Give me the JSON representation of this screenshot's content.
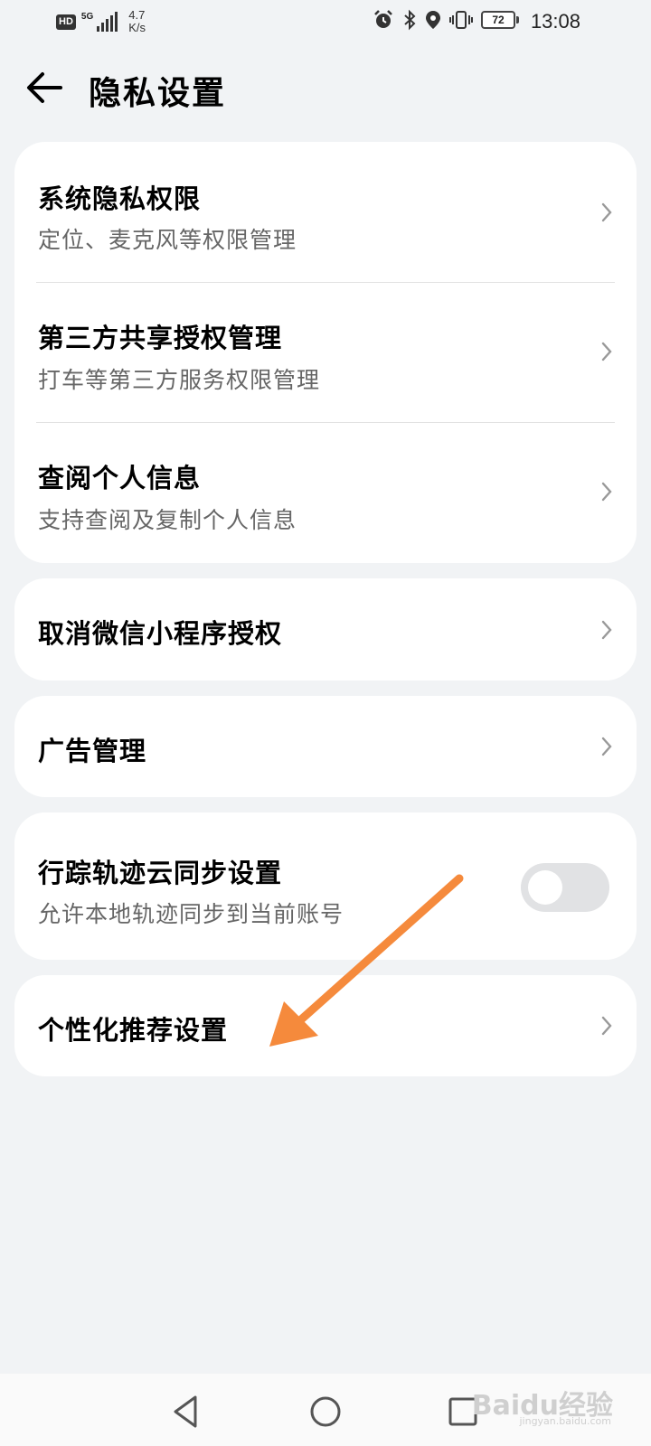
{
  "status_bar": {
    "hd": "HD",
    "network": "5G",
    "speed_value": "4.7",
    "speed_unit": "K/s",
    "battery": "72",
    "time": "13:08"
  },
  "header": {
    "title": "隐私设置"
  },
  "groups": [
    {
      "items": [
        {
          "title": "系统隐私权限",
          "subtitle": "定位、麦克风等权限管理"
        },
        {
          "title": "第三方共享授权管理",
          "subtitle": "打车等第三方服务权限管理"
        },
        {
          "title": "查阅个人信息",
          "subtitle": "支持查阅及复制个人信息"
        }
      ]
    },
    {
      "items": [
        {
          "title": "取消微信小程序授权"
        }
      ]
    },
    {
      "items": [
        {
          "title": "广告管理"
        }
      ]
    },
    {
      "items": [
        {
          "title": "行踪轨迹云同步设置",
          "subtitle": "允许本地轨迹同步到当前账号",
          "toggle_on": false
        }
      ]
    },
    {
      "items": [
        {
          "title": "个性化推荐设置"
        }
      ]
    }
  ],
  "colors": {
    "background": "#f1f3f5",
    "card": "#ffffff",
    "annotation_arrow": "#f58a3c"
  },
  "watermark": {
    "text": "Baidu经验",
    "sub": "jingyan.baidu.com"
  }
}
